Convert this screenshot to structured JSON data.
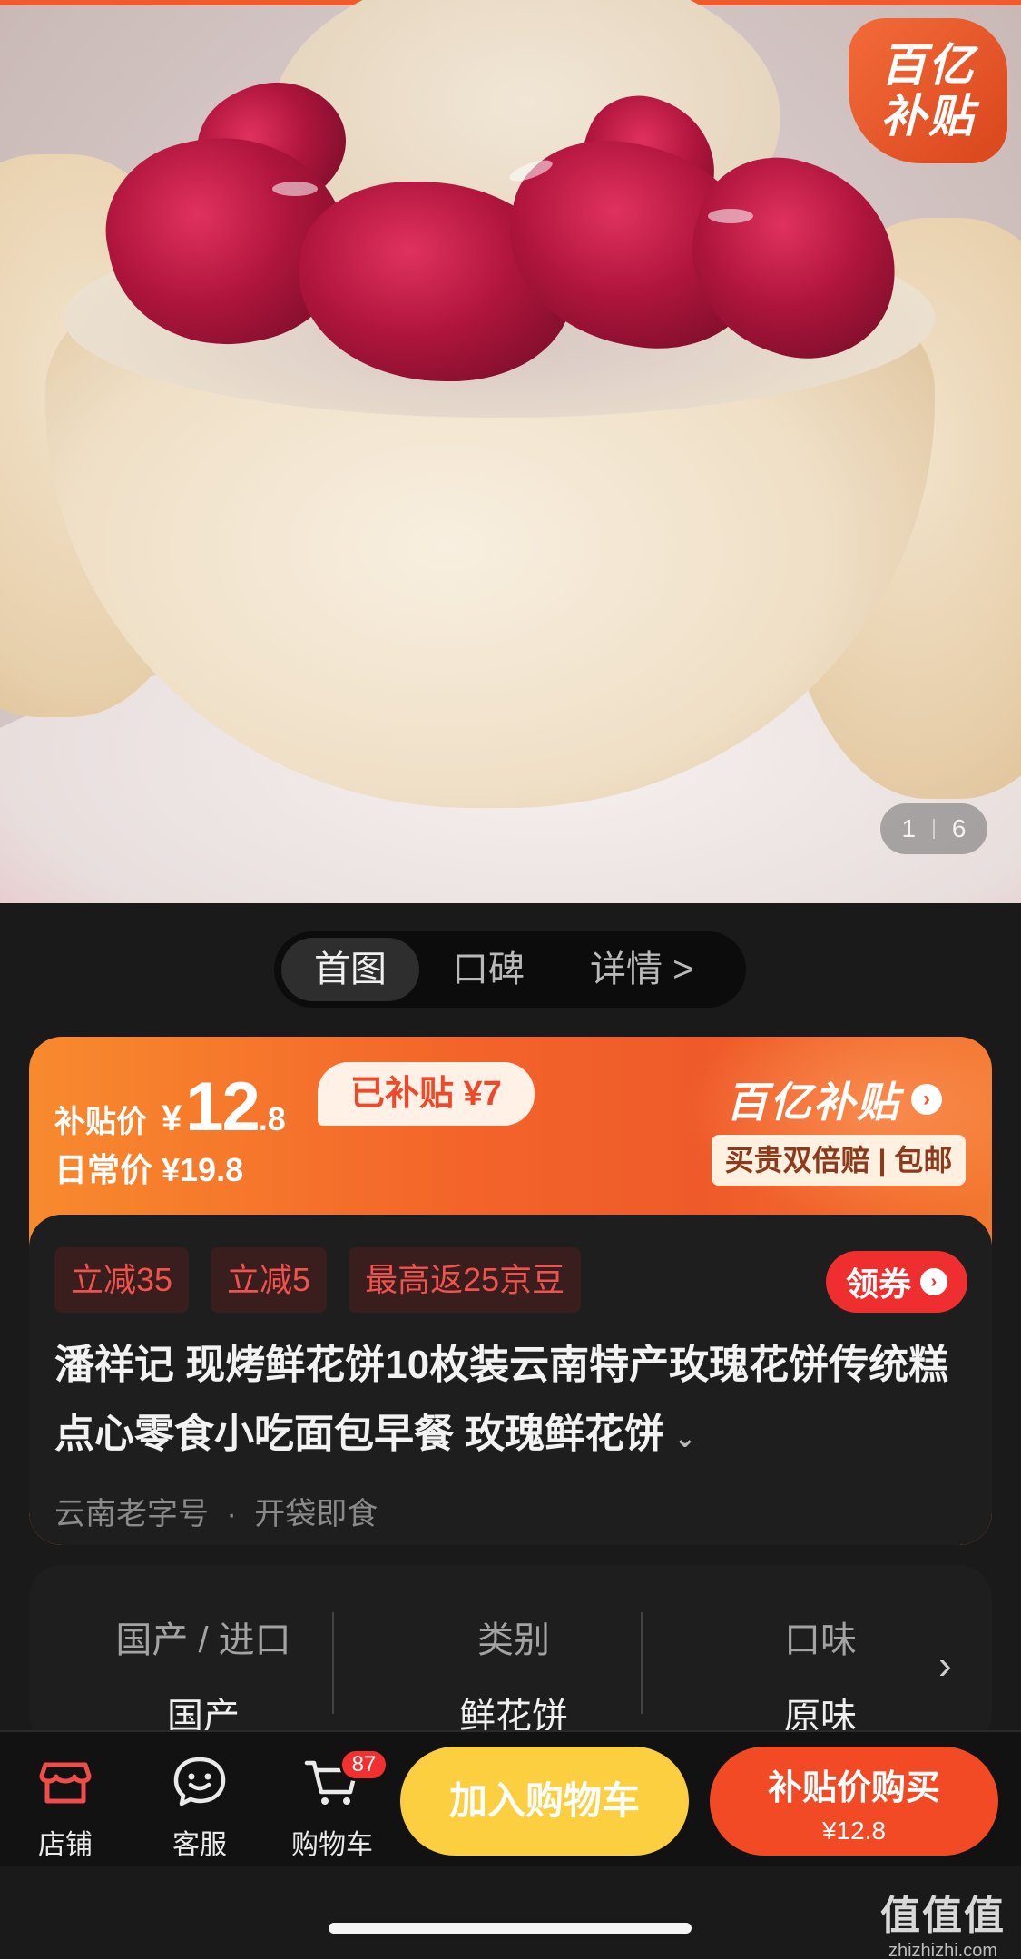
{
  "hero": {
    "badge_line1": "百亿",
    "badge_line2": "补贴",
    "pager_current": "1",
    "pager_total": "6"
  },
  "tabs": [
    {
      "label": "首图",
      "active": true
    },
    {
      "label": "口碑",
      "active": false
    },
    {
      "label": "详情 >",
      "active": false
    }
  ],
  "price": {
    "label": "补贴价",
    "currency": "¥",
    "integer": "12",
    "decimal": ".8",
    "subsidized_tag": "已补贴 ¥7",
    "daily_price": "日常价 ¥19.8",
    "brand_text": "百亿补贴",
    "brand_arrow": "›",
    "guarantee": "买贵双倍赔 | 包邮"
  },
  "promo_chips": [
    "立减35",
    "立减5",
    "最高返25京豆"
  ],
  "coupon_button": {
    "label": "领券",
    "arrow": "›"
  },
  "product": {
    "title": "潘祥记 现烤鲜花饼10枚装云南特产玫瑰花饼传统糕点心零食小吃面包早餐 玫瑰鲜花饼",
    "expand_caret": "⌄",
    "tags": [
      "云南老字号",
      "开袋即食"
    ]
  },
  "attributes": [
    {
      "key": "国产 / 进口",
      "value": "国产"
    },
    {
      "key": "类别",
      "value": "鲜花饼"
    },
    {
      "key": "口味",
      "value": "原味"
    }
  ],
  "attributes_arrow": "›",
  "bottom_bar": {
    "store_label": "店铺",
    "service_label": "客服",
    "cart_label": "购物车",
    "cart_count": "87",
    "add_to_cart": "加入购物车",
    "buy_line1": "补贴价购买",
    "buy_line2": "¥12.8"
  },
  "watermark": {
    "line1": "值值值",
    "line2": "zhizhizhi.com"
  },
  "colors": {
    "accent": "#ef5a2a",
    "cart_button": "#fbcf3f",
    "buy_button": "#f14a25",
    "chip_text": "#f0524d"
  }
}
